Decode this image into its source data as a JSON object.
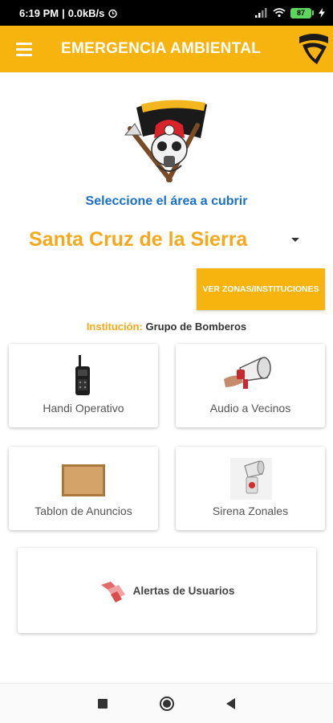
{
  "status_bar": {
    "time": "6:19 PM",
    "network_speed": "0.0kB/s",
    "battery_level": "87"
  },
  "app_bar": {
    "title": "EMERGENCIA AMBIENTAL",
    "menu_icon": "hamburger-menu-icon",
    "brand_icon": "shield-logo-icon"
  },
  "area": {
    "prompt": "Seleccione el área a cubrir",
    "selected_city": "Santa Cruz de la Sierra"
  },
  "zones_button": {
    "label": "VER ZONAS/INSTITUCIONES"
  },
  "institution": {
    "label": "Institución:",
    "value": "Grupo de Bomberos"
  },
  "actions": {
    "handi": {
      "label": "Handi Operativo",
      "icon": "radio-icon"
    },
    "audio": {
      "label": "Audio a Vecinos",
      "icon": "megaphone-icon"
    },
    "tablon": {
      "label": "Tablon de Anuncios",
      "icon": "corkboard-icon"
    },
    "sirena": {
      "label": "Sirena Zonales",
      "icon": "siren-icon"
    },
    "alertas": {
      "label": "Alertas de Usuarios",
      "icon": "handshake-icon"
    }
  },
  "colors": {
    "primary": "#f7b30e",
    "accent_text": "#f5a81c",
    "link_blue": "#1a6fc9"
  }
}
